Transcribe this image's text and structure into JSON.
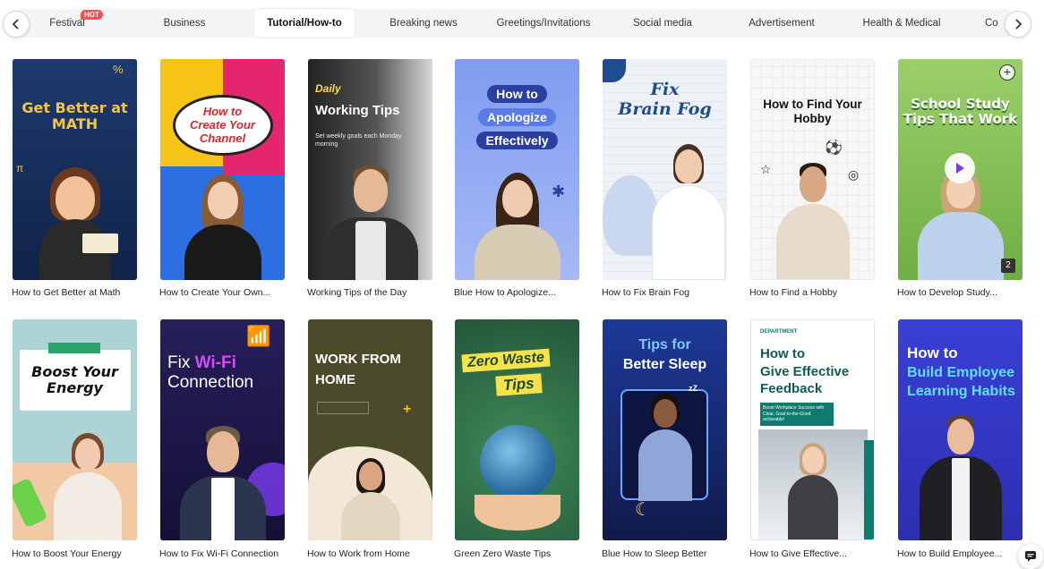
{
  "categories": {
    "prev_label": "previous",
    "next_label": "next",
    "hot_badge": "HOT",
    "tabs": [
      {
        "label": "Festival"
      },
      {
        "label": "Business"
      },
      {
        "label": "Tutorial/How-to",
        "active": true
      },
      {
        "label": "Breaking news"
      },
      {
        "label": "Greetings/Invitations"
      },
      {
        "label": "Social media"
      },
      {
        "label": "Advertisement"
      },
      {
        "label": "Health & Medical"
      },
      {
        "label": "Co"
      }
    ]
  },
  "templates": [
    {
      "caption": "How to Get Better at Math",
      "title": "Get Better at\nMATH",
      "bg": "#17305c",
      "accent": "#f5c542"
    },
    {
      "caption": "How to Create Your Own...",
      "title": "How to\nCreate Your\nChannel",
      "bg": "#2b6fe0",
      "accent": "#e0262b"
    },
    {
      "caption": "Working Tips of the Day",
      "title": "Working Tips",
      "kicker": "Daily",
      "subtitle": "Set weekly goals each Monday morning",
      "bg": "#3b3b3b",
      "accent": "#ffd84a"
    },
    {
      "caption": "Blue How to Apologize...",
      "title_lines": [
        "How to",
        "Apologize",
        "Effectively"
      ],
      "bg": "#8aa6f0",
      "accent": "#2b3f9e"
    },
    {
      "caption": "How to Fix Brain Fog",
      "title": "Fix\nBrain Fog",
      "bg": "#f4f7fb",
      "accent": "#1f4b8f"
    },
    {
      "caption": "How to Find a Hobby",
      "title": "How to Find Your\nHobby",
      "bg": "#f7f7f7",
      "accent": "#111111"
    },
    {
      "caption": "How to Develop Study...",
      "title": "School Study\nTips That Work",
      "bg": "#86c15a",
      "accent": "#ffffff",
      "count": "2"
    },
    {
      "caption": "How to Boost Your Energy",
      "title": "Boost Your\nEnergy",
      "bg": "#aed3d6",
      "accent": "#111111"
    },
    {
      "caption": "How to Fix Wi-Fi Connection",
      "title_a": "Fix",
      "title_b": "Wi-Fi",
      "title_c": "Connection",
      "bg": "#1f1a4d",
      "accent": "#d34cf0"
    },
    {
      "caption": "How to Work from Home",
      "title": "WORK FROM\nHOME",
      "bg": "#4b4a2a",
      "accent": "#f1b73c"
    },
    {
      "caption": "Green Zero Waste Tips",
      "title_a": "Zero Waste",
      "title_b": "Tips",
      "bg": "#2f6b45",
      "accent": "#f7e24a"
    },
    {
      "caption": "Blue How to Sleep Better",
      "title_a": "Tips for",
      "title_b": "Better Sleep",
      "bg": "#1b2a6b",
      "accent": "#7fc8ff"
    },
    {
      "caption": "How to Give Effective...",
      "title": "How to\nGive Effective\nFeedback",
      "brand": "DEPARTMENT",
      "subtitle": "Boost Workplace Success with Clear, Goal-to-the-Good actionable!",
      "bg": "#ffffff",
      "accent": "#0f7a6e"
    },
    {
      "caption": "How to Build Employee...",
      "title_a": "How to",
      "title_b": "Build Employee\nLearning Habits",
      "bg": "#3a3fd6",
      "accent": "#5fe0ff"
    }
  ]
}
